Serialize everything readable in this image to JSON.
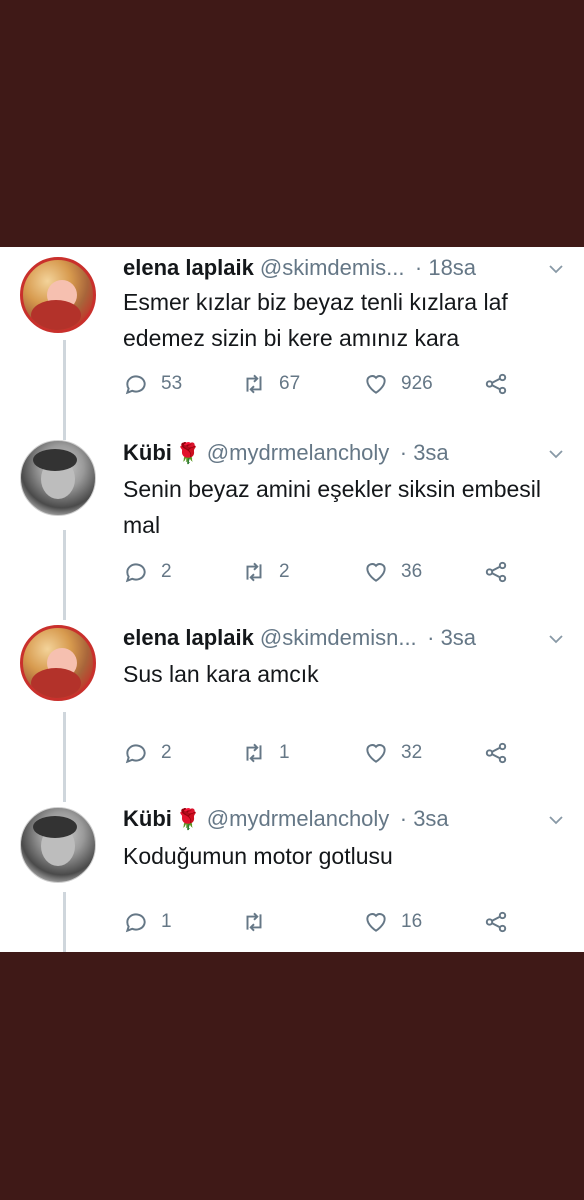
{
  "colors": {
    "background": "#3f1917",
    "panel": "#ffffff",
    "text": "#14171a",
    "muted": "#657786",
    "thread_line": "#cfd6dc"
  },
  "tweets": [
    {
      "name": "elena laplaik",
      "rose": "",
      "handle": "@skimdemis...",
      "time": "· 18sa",
      "text": "Esmer kızlar biz beyaz tenli kızlara laf edemez sizin bi kere amınız kara",
      "replies": "53",
      "retweets": "67",
      "likes": "926",
      "avatar_icon": "avatar-elena"
    },
    {
      "name": "Kübi",
      "rose": "🌹",
      "handle": "@mydrmelancholy",
      "time": "· 3sa",
      "text": "Senin beyaz amini eşekler siksin embesil mal",
      "replies": "2",
      "retweets": "2",
      "likes": "36",
      "avatar_icon": "avatar-kubi"
    },
    {
      "name": "elena laplaik",
      "rose": "",
      "handle": "@skimdemisn...",
      "time": "· 3sa",
      "text": "Sus lan kara amcık",
      "replies": "2",
      "retweets": "1",
      "likes": "32",
      "avatar_icon": "avatar-elena"
    },
    {
      "name": "Kübi",
      "rose": "🌹",
      "handle": "@mydrmelancholy",
      "time": "· 3sa",
      "text": "Koduğumun motor gotlusu",
      "replies": "1",
      "retweets": "",
      "likes": "16",
      "avatar_icon": "avatar-kubi"
    }
  ],
  "icons": {
    "reply": "reply-icon",
    "retweet": "retweet-icon",
    "like": "heart-icon",
    "share": "share-icon",
    "menu": "chevron-down-icon"
  }
}
